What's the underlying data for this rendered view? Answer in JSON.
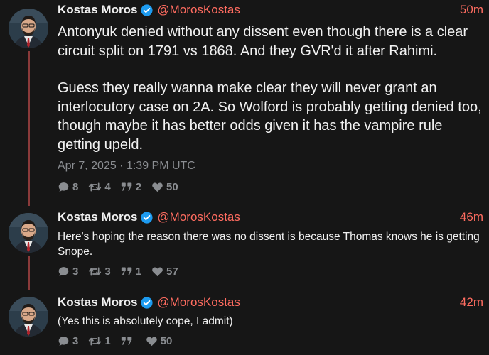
{
  "colors": {
    "background": "#161616",
    "accent": "#ff6c60",
    "muted": "#8a8d91",
    "verified": "#1d9bf0",
    "thread_line": "#8a3a3a"
  },
  "icons": {
    "verified": "verified-badge-icon",
    "replies": "comment-icon",
    "retweets": "retweet-icon",
    "quotes": "quote-icon",
    "likes": "heart-icon"
  },
  "tweets": [
    {
      "author": "Kostas Moros",
      "handle": "@MorosKostas",
      "time": "50m",
      "paragraphs": [
        "Antonyuk denied without any dissent even though there is a clear circuit split on 1791 vs 1868. And they GVR'd it after Rahimi.",
        "Guess they really wanna make clear they will never grant an interlocutory case on 2A. So Wolford is probably getting denied too, though maybe it has better odds given it has the vampire rule getting upeld."
      ],
      "date": "Apr 7, 2025 · 1:39 PM UTC",
      "stats": {
        "replies": "8",
        "retweets": "4",
        "quotes": "2",
        "likes": "50"
      }
    },
    {
      "author": "Kostas Moros",
      "handle": "@MorosKostas",
      "time": "46m",
      "text": "Here's hoping the reason there was no dissent is because Thomas knows he is getting Snope.",
      "stats": {
        "replies": "3",
        "retweets": "3",
        "quotes": "1",
        "likes": "57"
      }
    },
    {
      "author": "Kostas Moros",
      "handle": "@MorosKostas",
      "time": "42m",
      "text": "(Yes this is absolutely cope, I admit)",
      "stats": {
        "replies": "3",
        "retweets": "1",
        "quotes": "",
        "likes": "50"
      }
    }
  ]
}
